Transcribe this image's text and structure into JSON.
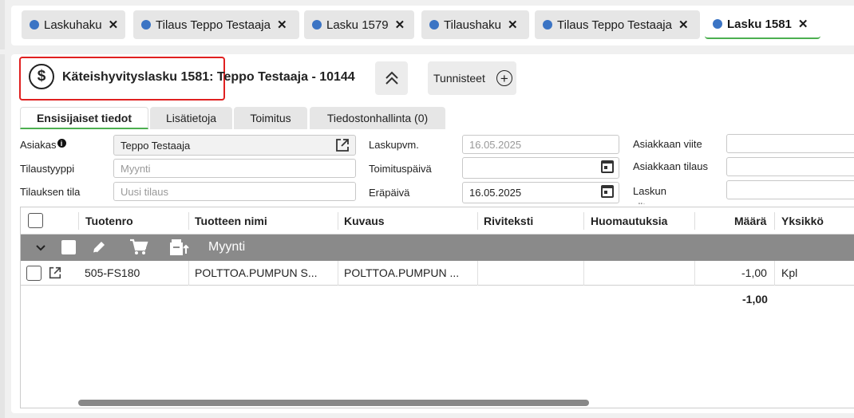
{
  "tabs": [
    {
      "label": "Laskuhaku",
      "active": false
    },
    {
      "label": "Tilaus Teppo Testaaja",
      "active": false
    },
    {
      "label": "Lasku 1579",
      "active": false
    },
    {
      "label": "Tilaushaku",
      "active": false
    },
    {
      "label": "Tilaus Teppo Testaaja",
      "active": false
    },
    {
      "label": "Lasku 1581",
      "active": true
    }
  ],
  "tab_close_glyph": "✕",
  "header": {
    "icon": "dollar-circle-icon",
    "icon_glyph": "$",
    "title": "Käteishyvityslasku 1581: Teppo Testaaja - 10144",
    "tags_label": "Tunnisteet",
    "plus_glyph": "+"
  },
  "section_tabs": [
    {
      "label": "Ensisijaiset tiedot",
      "active": true
    },
    {
      "label": "Lisätietoja",
      "active": false
    },
    {
      "label": "Toimitus",
      "active": false
    },
    {
      "label": "Tiedostonhallinta (0)",
      "active": false
    }
  ],
  "form": {
    "asiakas_label": "Asiakas",
    "asiakas_info_glyph": "i",
    "asiakas_value": "Teppo Testaaja",
    "tilaustyyppi_label": "Tilaustyyppi",
    "tilaustyyppi_placeholder": "Myynti",
    "tilauksen_tila_label": "Tilauksen tila",
    "tilauksen_tila_placeholder": "Uusi tilaus",
    "laskupvm_label": "Laskupvm.",
    "laskupvm_placeholder": "16.05.2025",
    "toimituspaiva_label": "Toimituspäivä",
    "toimituspaiva_value": "",
    "erapaiva_label": "Eräpäivä",
    "erapaiva_value": "16.05.2025",
    "asiakkaan_viite_label": "Asiakkaan viite",
    "asiakkaan_viite_value": "",
    "asiakkaan_tilaus_label": "Asiakkaan tilaus",
    "asiakkaan_tilaus_value": "",
    "laskun_viitenumero_label": "Laskun viitenumero",
    "laskun_viitenumero_value": ""
  },
  "grid": {
    "columns": [
      "Tuotenro",
      "Tuotteen nimi",
      "Kuvaus",
      "Riviteksti",
      "Huomautuksia",
      "Määrä",
      "Yksikkö"
    ],
    "group_label": "Myynti",
    "rows": [
      {
        "tuotenro": "505-FS180",
        "nimi": "POLTTOA.PUMPUN S...",
        "kuvaus": "POLTTOA.PUMPUN ...",
        "riviteksti": "",
        "huomautuksia": "",
        "maara": "-1,00",
        "yksikko": "Kpl"
      }
    ],
    "total_maara": "-1,00"
  },
  "colors": {
    "accent_green": "#4caf50",
    "dot_blue": "#3b74c4",
    "highlight_red": "#e02020",
    "group_gray": "#8a8a8a"
  }
}
